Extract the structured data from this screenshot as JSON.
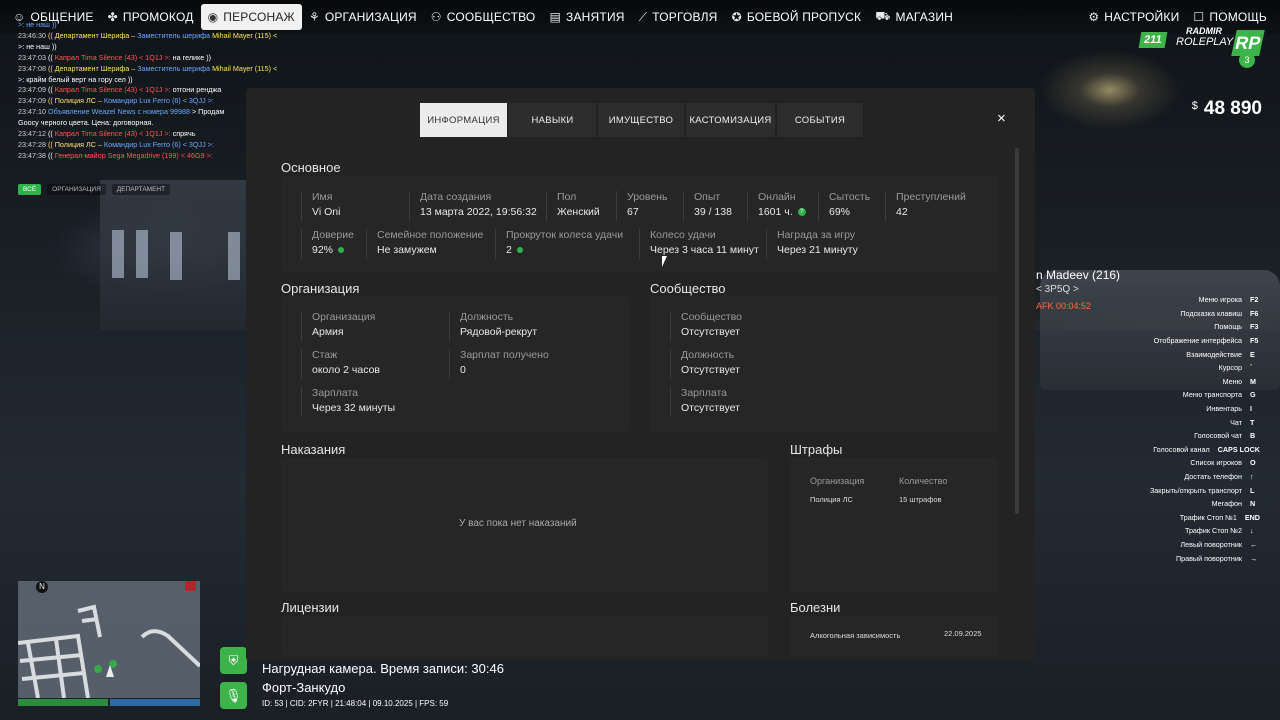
{
  "nav": {
    "items": [
      {
        "label": "ОБЩЕНИЕ",
        "icon": "chat-icon",
        "glyph": "☺"
      },
      {
        "label": "ПРОМОКОД",
        "icon": "promo-icon",
        "glyph": "✤"
      },
      {
        "label": "ПЕРСОНАЖ",
        "icon": "person-icon",
        "glyph": "◉",
        "active": true
      },
      {
        "label": "ОРГАНИЗАЦИЯ",
        "icon": "organization-icon",
        "glyph": "⚘"
      },
      {
        "label": "СООБЩЕСТВО",
        "icon": "community-icon",
        "glyph": "⚇"
      },
      {
        "label": "ЗАНЯТИЯ",
        "icon": "clipboard-icon",
        "glyph": "▤"
      },
      {
        "label": "ТОРГОВЛЯ",
        "icon": "trade-chart-icon",
        "glyph": "⟋"
      },
      {
        "label": "БОЕВОЙ ПРОПУСК",
        "icon": "battle-pass-icon",
        "glyph": "✪"
      },
      {
        "label": "МАГАЗИН",
        "icon": "cart-icon",
        "glyph": "⛟"
      }
    ],
    "right": [
      {
        "label": "НАСТРОЙКИ",
        "icon": "gear-icon",
        "glyph": "⚙"
      },
      {
        "label": "ПОМОЩЬ",
        "icon": "help-chat-icon",
        "glyph": "☐"
      }
    ]
  },
  "chat": {
    "lines": [
      [
        {
          "t": ">: не наш ))",
          "c": "c-blue"
        }
      ],
      [
        {
          "t": "23:46:30",
          "c": "chat-time"
        },
        {
          "t": "(( Департамент Шерифа – ",
          "c": "c-yellow"
        },
        {
          "t": "Заместитель шерифа ",
          "c": "c-blue"
        },
        {
          "t": "Mihail Mayer (115) < 3JS2",
          "c": "c-yellow"
        }
      ],
      [
        {
          "t": ">: не наш ))",
          "c": "c-white"
        }
      ],
      [
        {
          "t": "23:47:03",
          "c": "chat-time"
        },
        {
          "t": "(( ",
          "c": "c-white"
        },
        {
          "t": "Капрал Tima Silence (43) < 1Q1J >: ",
          "c": "c-red"
        },
        {
          "t": "на гелике ))",
          "c": "c-white"
        }
      ],
      [
        {
          "t": "23:47:08",
          "c": "chat-time"
        },
        {
          "t": "(( Департамент Шерифа – ",
          "c": "c-yellow"
        },
        {
          "t": "Заместитель шерифа ",
          "c": "c-blue"
        },
        {
          "t": "Mihail Mayer (115) < 3JS2",
          "c": "c-yellow"
        }
      ],
      [
        {
          "t": ">: крайм белый верт на горy сел ))",
          "c": "c-white"
        }
      ],
      [
        {
          "t": "23:47:09",
          "c": "chat-time"
        },
        {
          "t": "(( ",
          "c": "c-white"
        },
        {
          "t": "Капрал Tima Silence (43) < 1Q1J >: ",
          "c": "c-red"
        },
        {
          "t": "отгони ренджа",
          "c": "c-white"
        }
      ],
      [
        {
          "t": "23:47:09",
          "c": "chat-time"
        },
        {
          "t": "(( Полиция ЛС – ",
          "c": "c-yellow"
        },
        {
          "t": "Командир Lux Ferro (6) < 3QJJ >: ",
          "c": "c-blue"
        }
      ],
      [
        {
          "t": "23:47:10",
          "c": "chat-time"
        },
        {
          "t": "Объявление Weazel News ",
          "c": "c-blue"
        },
        {
          "t": "с номера 99988 ",
          "c": "c-blue"
        },
        {
          "t": "> Продам",
          "c": "c-white"
        }
      ],
      [
        {
          "t": "Goocy черного цвета. Цена: договорная.",
          "c": "c-white"
        }
      ],
      [
        {
          "t": "23:47:12",
          "c": "chat-time"
        },
        {
          "t": "(( ",
          "c": "c-white"
        },
        {
          "t": "Капрал Tima Silence (43) < 1Q1J >: ",
          "c": "c-red"
        },
        {
          "t": "спрячь",
          "c": "c-white"
        }
      ],
      [
        {
          "t": "23:47:28",
          "c": "chat-time"
        },
        {
          "t": "(( Полиция ЛС – ",
          "c": "c-yellow"
        },
        {
          "t": "Командир Lux Ferro (6) < 3QJJ >: ",
          "c": "c-blue"
        }
      ],
      [
        {
          "t": "23:47:38",
          "c": "chat-time"
        },
        {
          "t": "(( ",
          "c": "c-white"
        },
        {
          "t": "Генерал-майор Sega Megadrive (199) < 46G9 >: ",
          "c": "c-red"
        }
      ]
    ],
    "tabs": [
      {
        "label": "ВСЁ",
        "active": true
      },
      {
        "label": "ОРГАНИЗАЦИЯ"
      },
      {
        "label": "ДЕПАРТАМЕНТ"
      }
    ]
  },
  "logo": {
    "badge": "211",
    "line1": "RADMIR",
    "line2": "ROLEPLAY",
    "mark": "RP",
    "server": "3"
  },
  "money": {
    "symbol": "$",
    "amount": "48 890"
  },
  "nametag": {
    "name": "n Madeev (216)",
    "id": "< 3P5Q >",
    "afk": "AFK 00:04:52"
  },
  "keybinds": [
    {
      "label": "Меню игрока",
      "key": "F2"
    },
    {
      "label": "Подсказка клавиш",
      "key": "F6"
    },
    {
      "label": "Помощь",
      "key": "F3"
    },
    {
      "label": "Отображение интерфейса",
      "key": "F5"
    },
    {
      "label": "Взаимодействие",
      "key": "E"
    },
    {
      "label": "Курсор",
      "key": "`"
    },
    {
      "label": "Меню",
      "key": "M"
    },
    {
      "label": "Меню транспорта",
      "key": "G"
    },
    {
      "label": "Инвентарь",
      "key": "I"
    },
    {
      "label": "Чат",
      "key": "T"
    },
    {
      "label": "Голосовой чат",
      "key": "B"
    },
    {
      "label": "Голосовой канал",
      "key": "CAPS LOCK"
    },
    {
      "label": "Список игроков",
      "key": "O"
    },
    {
      "label": "Достать телефон",
      "key": "↑"
    },
    {
      "label": "Закрыть/открыть транспорт",
      "key": "L"
    },
    {
      "label": "Мегафон",
      "key": "N"
    },
    {
      "label": "Трафик Стоп №1",
      "key": "END"
    },
    {
      "label": "Трафик Стоп №2",
      "key": "↓"
    },
    {
      "label": "Левый поворотник",
      "key": "←"
    },
    {
      "label": "Правый поворотник",
      "key": "→"
    }
  ],
  "minimap": {
    "north": "N"
  },
  "hud": {
    "bodycam": "Нагрудная камера. Время записи: 30:46",
    "location": "Форт-Занкудо",
    "status": "ID: 53 | CID: 2FYR | 21:48:04 | 09.10.2025 | FPS: 59"
  },
  "modal": {
    "tabs": [
      {
        "label": "ИНФОРМАЦИЯ",
        "active": true,
        "w": 87
      },
      {
        "label": "НАВЫКИ",
        "w": 87
      },
      {
        "label": "ИМУЩЕСТВО",
        "w": 86
      },
      {
        "label": "КАСТОМИЗАЦИЯ",
        "w": 89
      },
      {
        "label": "СОБЫТИЯ",
        "w": 86
      }
    ],
    "close": "×",
    "basic": {
      "title": "Основное",
      "name": {
        "label": "Имя",
        "value": "Vi Oni"
      },
      "created": {
        "label": "Дата создания",
        "value": "13 марта 2022, 19:56:32"
      },
      "gender": {
        "label": "Пол",
        "value": "Женский"
      },
      "level": {
        "label": "Уровень",
        "value": "67"
      },
      "exp": {
        "label": "Опыт",
        "value": "39 / 138"
      },
      "online": {
        "label": "Онлайн",
        "value": "1601 ч."
      },
      "satiety": {
        "label": "Сытость",
        "value": "69%"
      },
      "crimes": {
        "label": "Преступлений",
        "value": "42"
      },
      "trust": {
        "label": "Доверие",
        "value": "92%"
      },
      "family": {
        "label": "Семейное положение",
        "value": "Не замужем"
      },
      "spins": {
        "label": "Прокруток колеса удачи",
        "value": "2"
      },
      "wheel": {
        "label": "Колесо удачи",
        "value": "Через 3 часа 11 минут"
      },
      "reward": {
        "label": "Награда за игру",
        "value": "Через 21 минуту"
      }
    },
    "org": {
      "title": "Организация",
      "org": {
        "label": "Организация",
        "value": "Армия"
      },
      "position": {
        "label": "Должность",
        "value": "Рядовой-рекрут"
      },
      "tenure": {
        "label": "Стаж",
        "value": "около 2 часов"
      },
      "salaries": {
        "label": "Зарплат получено",
        "value": "0"
      },
      "salary": {
        "label": "Зарплата",
        "value": "Через 32 минуты"
      }
    },
    "community": {
      "title": "Сообщество",
      "community": {
        "label": "Сообщество",
        "value": "Отсутствует"
      },
      "position": {
        "label": "Должность",
        "value": "Отсутствует"
      },
      "salary": {
        "label": "Зарплата",
        "value": "Отсутствует"
      }
    },
    "punishments": {
      "title": "Наказания",
      "empty": "У вас пока нет наказаний"
    },
    "fines": {
      "title": "Штрафы",
      "col_org": "Организация",
      "col_count": "Количество",
      "rows": [
        {
          "org": "Полиция ЛС",
          "count": "15 штрафов"
        }
      ]
    },
    "licenses": {
      "title": "Лицензии"
    },
    "diseases": {
      "title": "Болезни",
      "rows": [
        {
          "name": "Алкогольная зависимость",
          "date": "22.09.2025"
        }
      ]
    }
  }
}
